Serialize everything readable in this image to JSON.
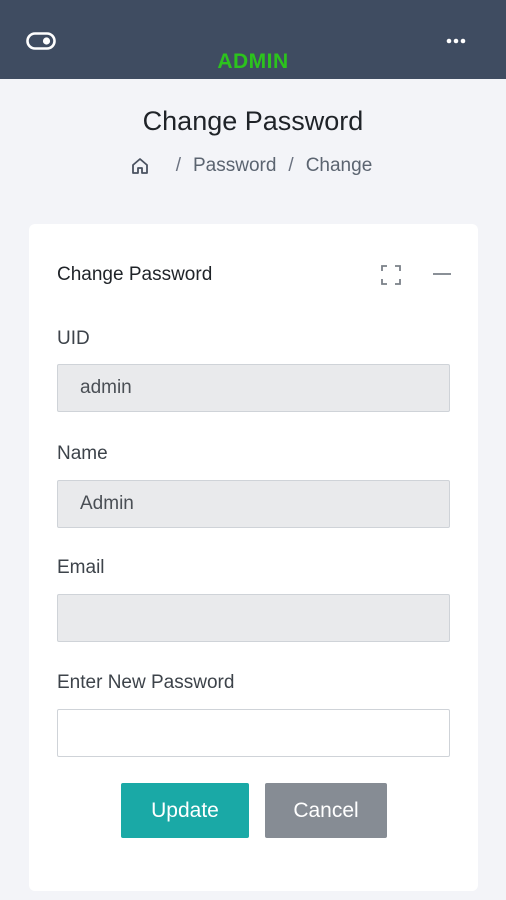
{
  "header": {
    "brand": "ADMIN",
    "menu_icon": "toggle-icon",
    "more_icon": "more-horizontal-icon",
    "background": "#3f4c61",
    "brand_color": "#2cc31d"
  },
  "page": {
    "title": "Change Password",
    "breadcrumb": {
      "home_icon": "home-icon",
      "items": [
        "Password",
        "Change"
      ]
    }
  },
  "card": {
    "title": "Change Password",
    "expand_icon": "expand-icon",
    "collapse_icon": "minus-icon",
    "fields": {
      "uid": {
        "label": "UID",
        "value": "admin"
      },
      "name": {
        "label": "Name",
        "value": "Admin"
      },
      "email": {
        "label": "Email",
        "value": ""
      },
      "new_password": {
        "label": "Enter New Password",
        "value": ""
      }
    },
    "buttons": {
      "update": "Update",
      "cancel": "Cancel"
    },
    "colors": {
      "update": "#1aa9a6",
      "cancel": "#868c94"
    }
  }
}
